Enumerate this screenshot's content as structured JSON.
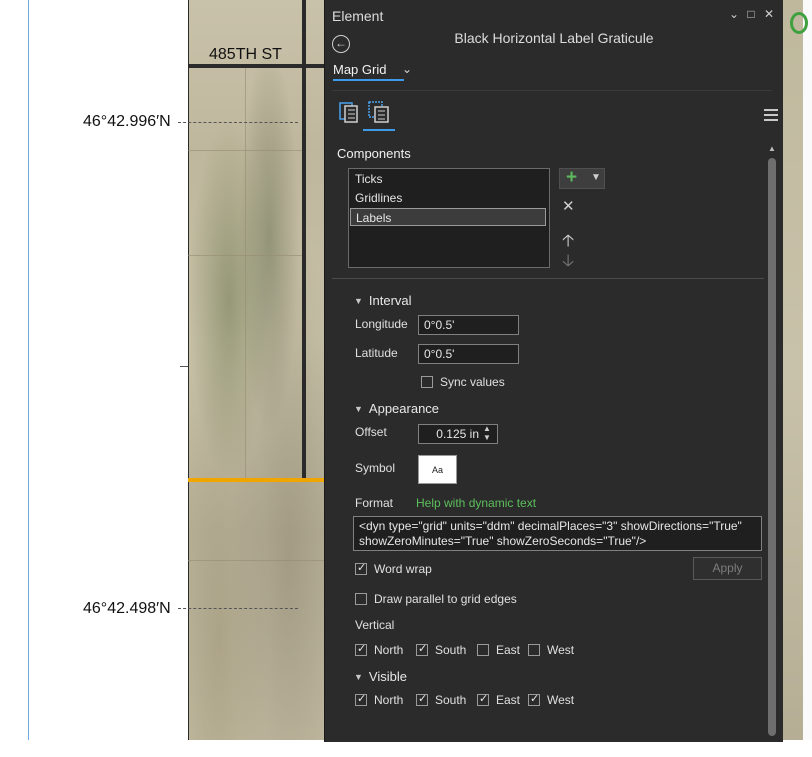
{
  "map": {
    "street_label": "485TH ST",
    "grid_labels": [
      "46°42.996′N",
      "46°42.498′N"
    ]
  },
  "pane": {
    "title": "Element",
    "window_buttons": [
      "⌄",
      "□",
      "✕"
    ],
    "element_name": "Black Horizontal Label Graticule",
    "dropdown_value": "Map Grid",
    "components": {
      "heading": "Components",
      "items": [
        "Ticks",
        "Gridlines",
        "Labels"
      ],
      "selected": "Labels"
    },
    "interval": {
      "heading": "Interval",
      "longitude_label": "Longitude",
      "longitude_value": "0°0.5'",
      "latitude_label": "Latitude",
      "latitude_value": "0°0.5'",
      "sync_label": "Sync values",
      "sync_checked": false
    },
    "appearance": {
      "heading": "Appearance",
      "offset_label": "Offset",
      "offset_value": "0.125 in",
      "symbol_label": "Symbol",
      "symbol_preview": "Aa",
      "format_label": "Format",
      "help_link": "Help with dynamic text",
      "format_text": "<dyn type=\"grid\" units=\"ddm\" decimalPlaces=\"3\" showDirections=\"True\" showZeroMinutes=\"True\" showZeroSeconds=\"True\"/>",
      "word_wrap_label": "Word wrap",
      "word_wrap_checked": true,
      "apply_label": "Apply",
      "parallel_label": "Draw parallel to grid edges",
      "parallel_checked": false,
      "vertical_label": "Vertical",
      "vertical": [
        {
          "label": "North",
          "checked": true
        },
        {
          "label": "South",
          "checked": true
        },
        {
          "label": "East",
          "checked": false
        },
        {
          "label": "West",
          "checked": false
        }
      ]
    },
    "visible": {
      "heading": "Visible",
      "items": [
        {
          "label": "North",
          "checked": true
        },
        {
          "label": "South",
          "checked": true
        },
        {
          "label": "East",
          "checked": true
        },
        {
          "label": "West",
          "checked": true
        }
      ]
    },
    "colors": {
      "accent": "#3d9be9",
      "link": "#5cbf5c",
      "background": "#2b2b2b"
    }
  }
}
